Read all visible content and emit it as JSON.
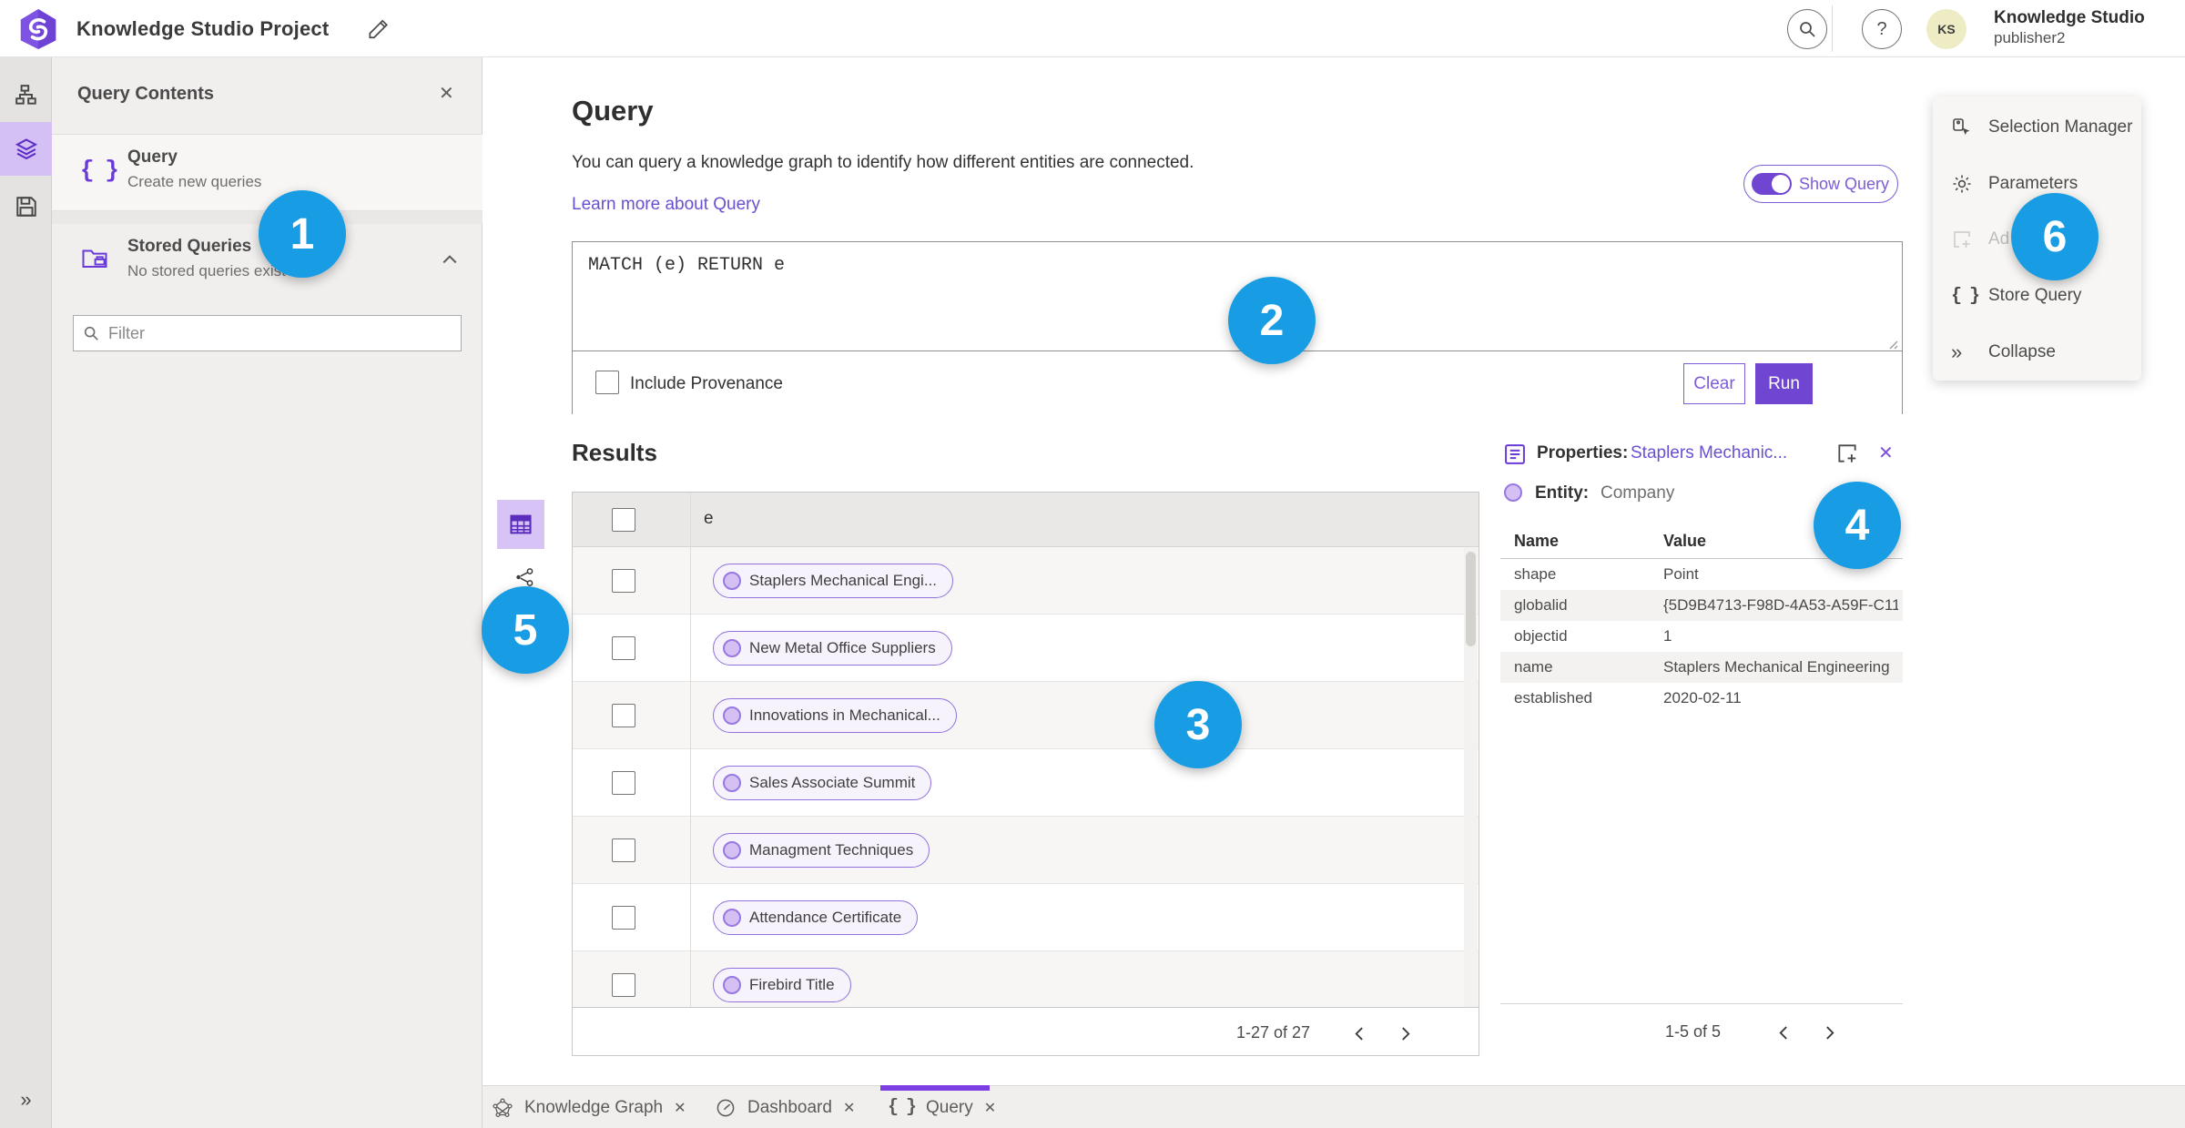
{
  "topbar": {
    "title": "Knowledge Studio Project",
    "user_name": "Knowledge Studio",
    "user_role": "publisher2",
    "avatar_initials": "KS"
  },
  "icons": {
    "help": "?",
    "close": "✕",
    "braces": "{ }",
    "collapse_chevrons": "»",
    "expand_chevrons": "»"
  },
  "contents_panel": {
    "title": "Query Contents",
    "query_item": {
      "title": "Query",
      "subtitle": "Create new queries"
    },
    "stored_item": {
      "title": "Stored Queries",
      "subtitle": "No stored queries exist"
    },
    "filter_placeholder": "Filter"
  },
  "query_panel": {
    "heading": "Query",
    "description": "You can query a knowledge graph to identify how different entities are connected.",
    "learn_more": "Learn more about Query",
    "show_query": "Show Query",
    "code": "MATCH (e) RETURN e",
    "include_provenance": "Include Provenance",
    "clear": "Clear",
    "run": "Run"
  },
  "results": {
    "heading": "Results",
    "column_header": "e",
    "rows": [
      "Staplers Mechanical Engi...",
      "New Metal Office Suppliers",
      "Innovations in Mechanical...",
      "Sales Associate Summit",
      "Managment Techniques",
      "Attendance Certificate",
      "Firebird Title"
    ],
    "pagination": "1-27 of 27"
  },
  "properties": {
    "label": "Properties:",
    "entity_link": "Staplers Mechanic...",
    "entity_label": "Entity:",
    "entity_type": "Company",
    "col_name": "Name",
    "col_value": "Value",
    "rows": [
      {
        "name": "shape",
        "value": "Point"
      },
      {
        "name": "globalid",
        "value": "{5D9B4713-F98D-4A53-A59F-C11..."
      },
      {
        "name": "objectid",
        "value": "1"
      },
      {
        "name": "name",
        "value": "Staplers Mechanical Engineering"
      },
      {
        "name": "established",
        "value": "2020-02-11"
      }
    ],
    "pagination": "1-5 of 5"
  },
  "tools": {
    "selection_manager": "Selection Manager",
    "parameters": "Parameters",
    "add_disabled": "Ad",
    "store_query": "Store Query",
    "collapse": "Collapse"
  },
  "tabs": {
    "knowledge_graph": "Knowledge Graph",
    "dashboard": "Dashboard",
    "query": "Query"
  },
  "badges": {
    "b1": "1",
    "b2": "2",
    "b3": "3",
    "b4": "4",
    "b5": "5",
    "b6": "6"
  },
  "colors": {
    "accent_purple": "#6f45d1",
    "light_purple": "#d5c0f3",
    "badge_blue": "#189de5",
    "link_purple": "#6a4fd2"
  }
}
